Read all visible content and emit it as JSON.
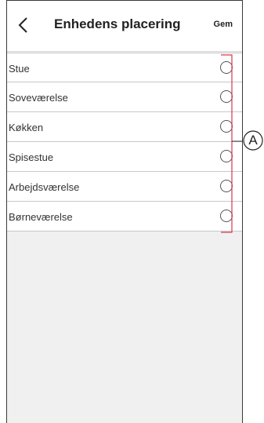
{
  "header": {
    "title": "Enhedens placering",
    "save_label": "Gem"
  },
  "rooms": [
    {
      "label": "Stue",
      "selected": false
    },
    {
      "label": "Soveværelse",
      "selected": false
    },
    {
      "label": "Køkken",
      "selected": false
    },
    {
      "label": "Spisestue",
      "selected": false
    },
    {
      "label": "Arbejdsværelse",
      "selected": false
    },
    {
      "label": "Børneværelse",
      "selected": false
    }
  ],
  "annotation": {
    "callout_letter": "A",
    "bracket_color": "#d43a4f"
  }
}
